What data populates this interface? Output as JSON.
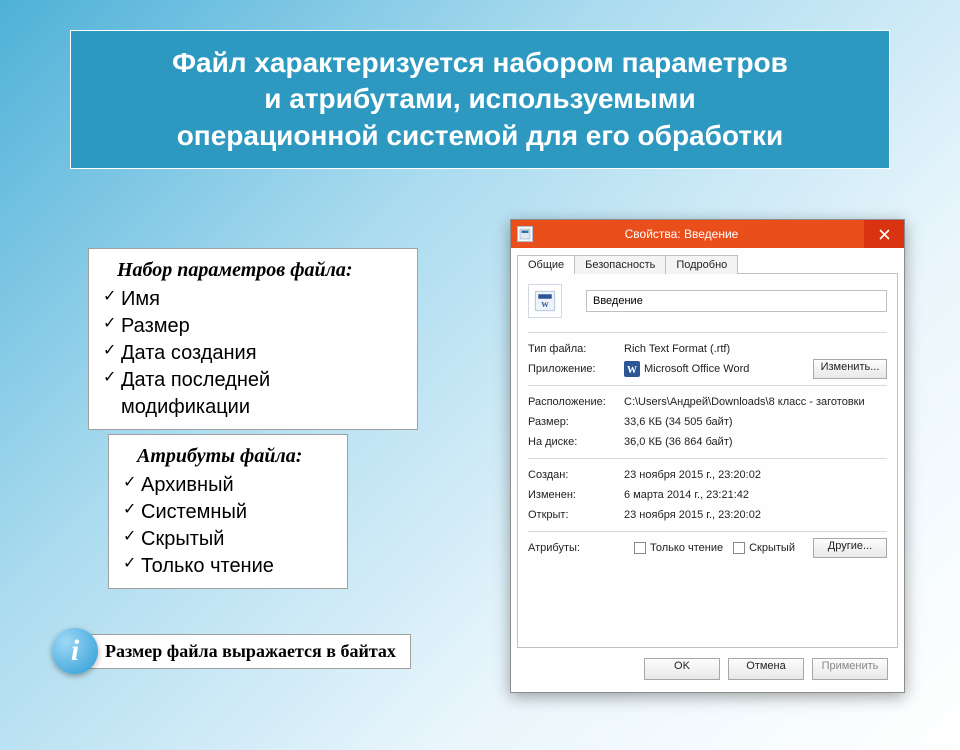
{
  "banner": {
    "line1": "Файл характеризуется набором параметров",
    "line2": "и атрибутами, используемыми",
    "line3": "операционной системой для его обработки"
  },
  "params": {
    "heading": "Набор параметров файла:",
    "items": [
      "Имя",
      "Размер",
      "Дата создания",
      "Дата последней модификации"
    ]
  },
  "attrs": {
    "heading": "Атрибуты файла:",
    "items": [
      "Архивный",
      "Системный",
      "Скрытый",
      "Только чтение"
    ]
  },
  "info": {
    "glyph": "i",
    "text": "Размер файла выражается в байтах"
  },
  "dialog": {
    "title": "Свойства: Введение",
    "tabs": [
      "Общие",
      "Безопасность",
      "Подробно"
    ],
    "filename": "Введение",
    "rows": {
      "type": {
        "label": "Тип файла:",
        "value": "Rich Text Format (.rtf)"
      },
      "app": {
        "label": "Приложение:",
        "value": "Microsoft Office Word"
      },
      "location": {
        "label": "Расположение:",
        "value": "C:\\Users\\Андрей\\Downloads\\8 класс - заготовки"
      },
      "size": {
        "label": "Размер:",
        "value": "33,6 КБ (34 505 байт)"
      },
      "ondisk": {
        "label": "На диске:",
        "value": "36,0 КБ (36 864 байт)"
      },
      "created": {
        "label": "Создан:",
        "value": "23 ноября 2015 г., 23:20:02"
      },
      "modified": {
        "label": "Изменен:",
        "value": "6 марта 2014 г., 23:21:42"
      },
      "accessed": {
        "label": "Открыт:",
        "value": "23 ноября 2015 г., 23:20:02"
      },
      "attributes": {
        "label": "Атрибуты:",
        "readonly": "Только чтение",
        "hidden": "Скрытый"
      }
    },
    "buttons": {
      "change": "Изменить...",
      "other": "Другие...",
      "ok": "OK",
      "cancel": "Отмена",
      "apply": "Применить"
    }
  }
}
